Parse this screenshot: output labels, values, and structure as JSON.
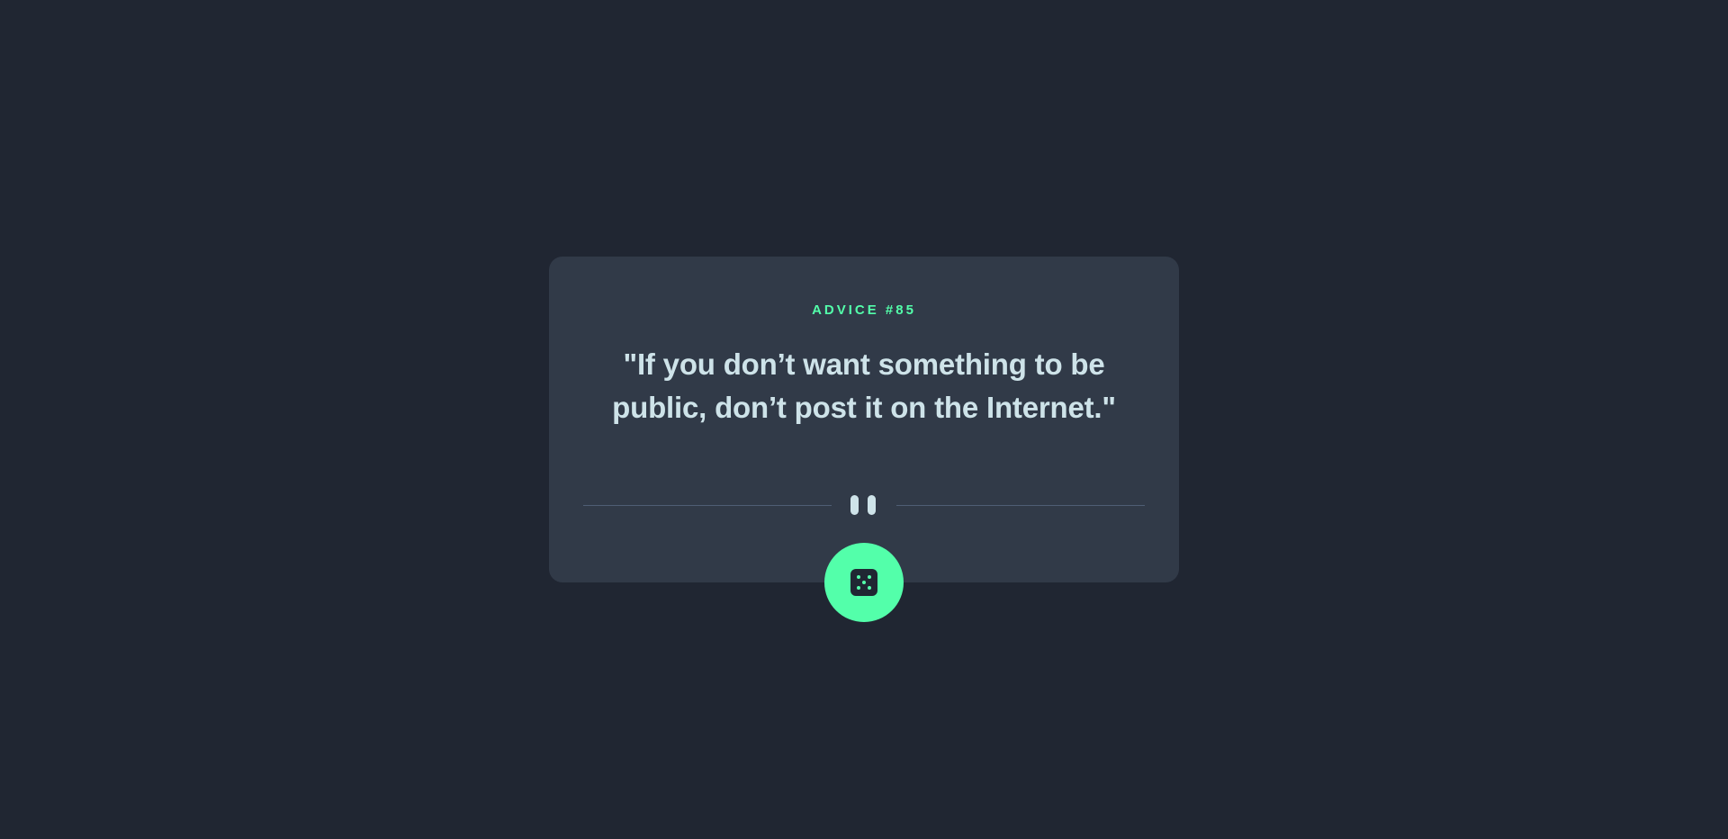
{
  "advice": {
    "label": "ADVICE #85",
    "quote": "\"If you don’t want something to be public, don’t post it on the Internet.\""
  },
  "colors": {
    "background": "#202632",
    "card": "#313A48",
    "accent": "#53FFAA",
    "text": "#CEE3E9",
    "divider": "#4F5D74"
  },
  "icons": {
    "divider_icon": "pause-icon",
    "button_icon": "dice-icon"
  }
}
